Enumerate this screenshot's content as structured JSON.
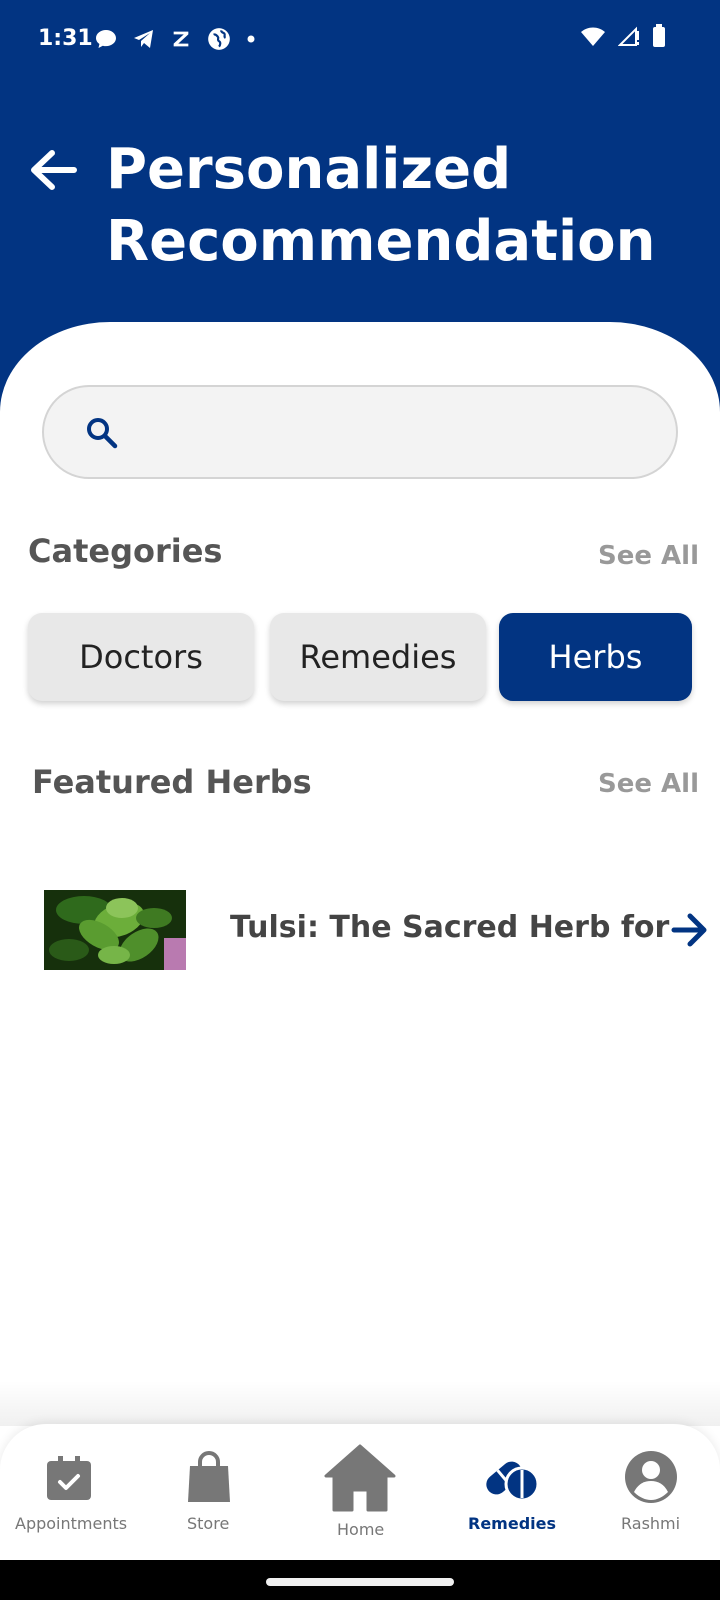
{
  "status_bar": {
    "time": "1:31",
    "left_icons": [
      "message-icon",
      "telegram-icon",
      "z-app-icon",
      "globe-app-icon",
      "dot-icon"
    ],
    "right_icons": [
      "wifi-icon",
      "signal-icon",
      "battery-icon"
    ]
  },
  "header": {
    "title": "Personalized Recommendation",
    "background_color": "#023482"
  },
  "search": {
    "placeholder": "",
    "value": ""
  },
  "categories": {
    "title": "Categories",
    "see_all": "See All",
    "items": [
      {
        "label": "Doctors",
        "active": false
      },
      {
        "label": "Remedies",
        "active": false
      },
      {
        "label": "Herbs",
        "active": true
      }
    ]
  },
  "featured": {
    "title": "Featured Herbs",
    "see_all": "See All",
    "items": [
      {
        "title": "Tulsi: The Sacred Herb for",
        "image": "tulsi-leaves-image"
      }
    ]
  },
  "bottom_nav": {
    "items": [
      {
        "label": "Appointments",
        "icon": "calendar-check-icon",
        "active": false
      },
      {
        "label": "Store",
        "icon": "shopping-bag-icon",
        "active": false
      },
      {
        "label": "Home",
        "icon": "home-icon",
        "active": false
      },
      {
        "label": "Remedies",
        "icon": "pills-icon",
        "active": true
      },
      {
        "label": "Rashmi",
        "icon": "account-circle-icon",
        "active": false
      }
    ]
  },
  "colors": {
    "primary": "#023482",
    "chip_inactive": "#e8e8e8",
    "nav_inactive": "#777777"
  }
}
